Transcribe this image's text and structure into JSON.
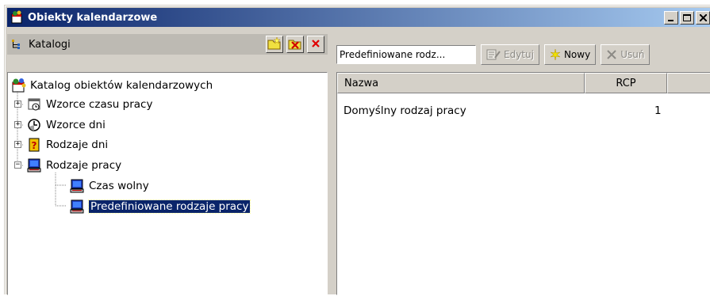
{
  "window": {
    "title": "Obiekty kalendarzowe"
  },
  "left_pane": {
    "header_label": "Katalogi",
    "tools": {
      "new_icon": "new-folder-icon",
      "delete_folder_icon": "delete-folder-icon",
      "remove_icon": "red-x-icon"
    }
  },
  "tree": {
    "root": "Katalog obiektów kalendarzowych",
    "items": [
      {
        "label": "Wzorce czasu pracy",
        "icon": "calendar-icon",
        "expander": "+"
      },
      {
        "label": "Wzorce dni",
        "icon": "clock-icon",
        "expander": "+"
      },
      {
        "label": "Rodzaje dni",
        "icon": "day-type-icon",
        "expander": "+"
      },
      {
        "label": "Rodzaje pracy",
        "icon": "computer-icon",
        "expander": "−"
      },
      {
        "label": "Czas wolny",
        "icon": "computer-icon"
      },
      {
        "label": "Predefiniowane rodzaje pracy",
        "icon": "computer-icon",
        "selected": true
      }
    ]
  },
  "toolbar": {
    "combo_value": "Predefiniowane rodz...",
    "edit_label": "Edytuj",
    "new_label": "Nowy",
    "delete_label": "Usuń"
  },
  "list": {
    "columns": [
      "Nazwa",
      "RCP"
    ],
    "rows": [
      {
        "name": "Domyślny rodzaj pracy",
        "rcp": "1"
      }
    ]
  }
}
